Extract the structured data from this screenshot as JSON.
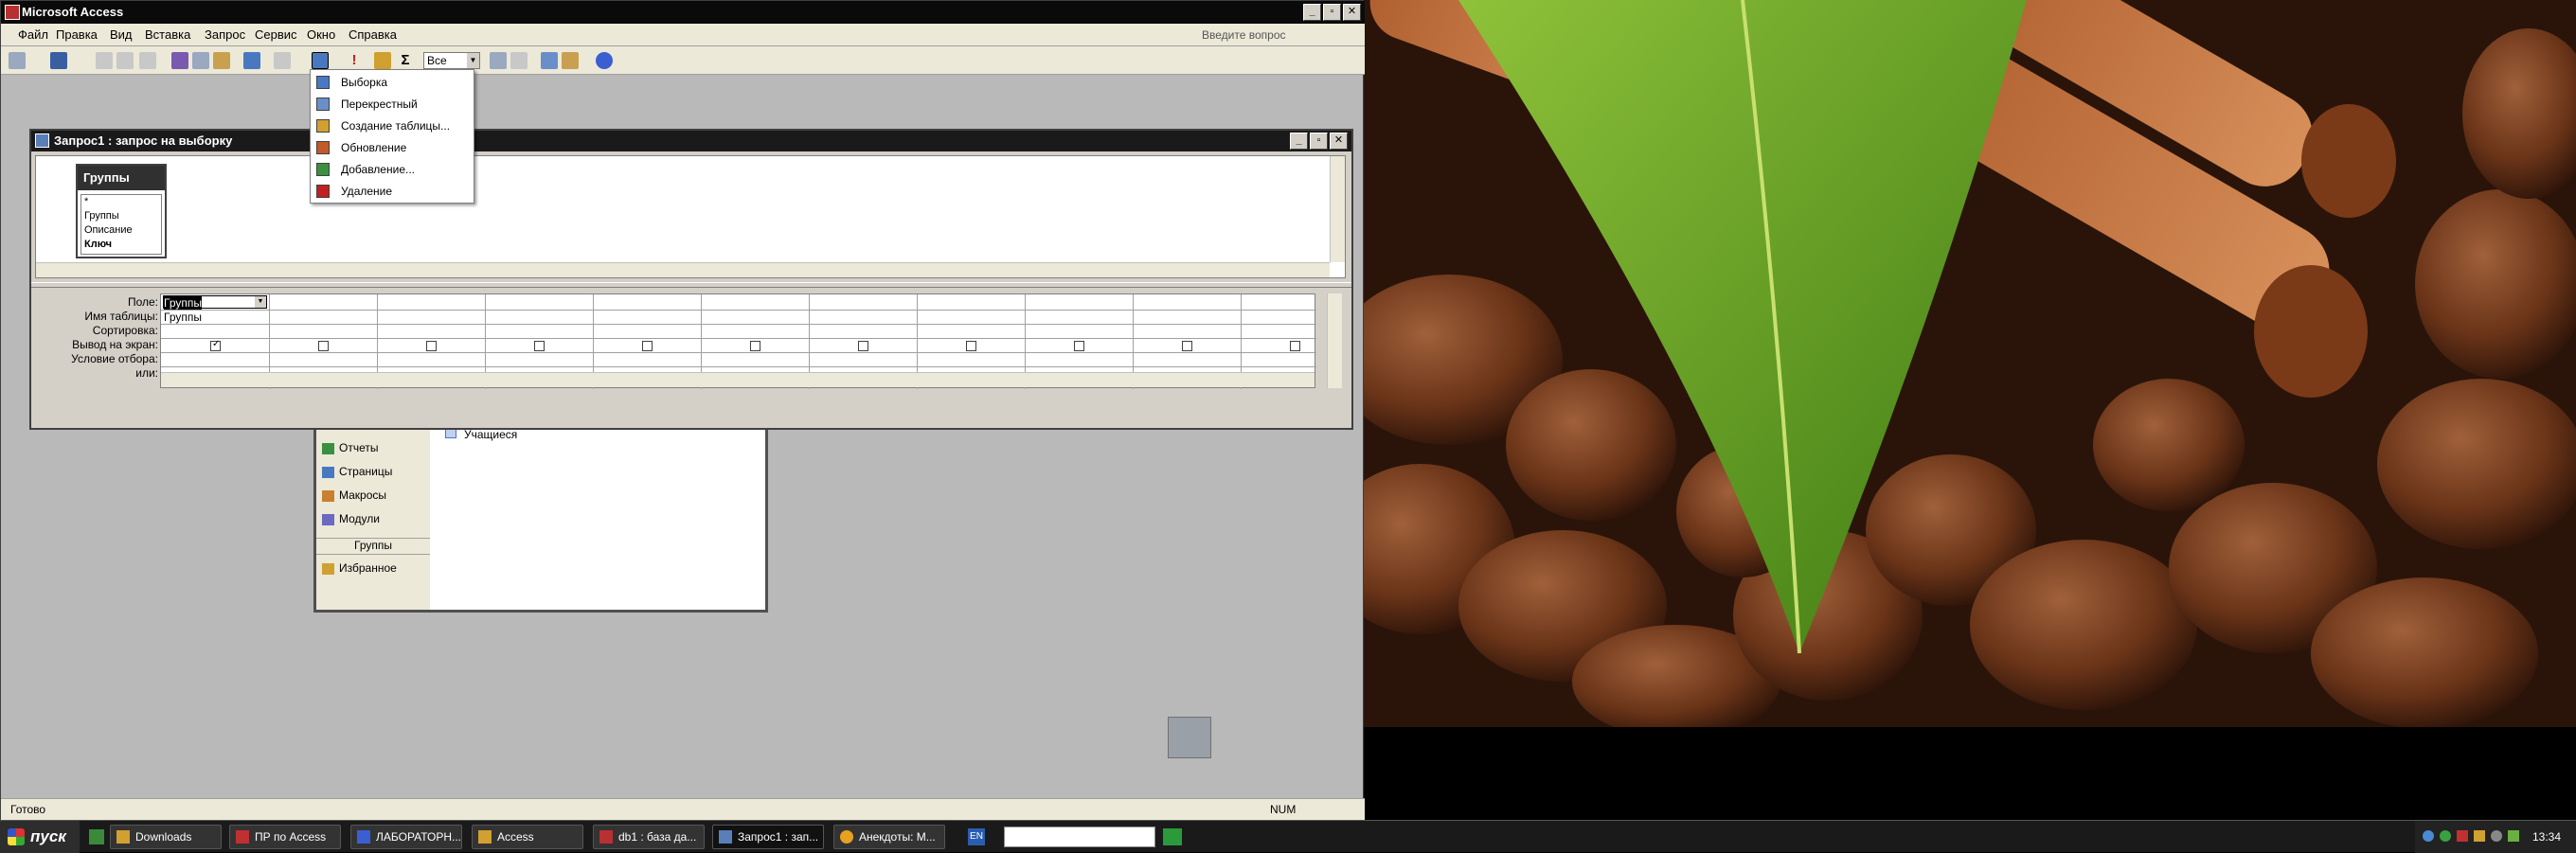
{
  "window": {
    "title": "Microsoft Access",
    "help_placeholder": "Введите вопрос"
  },
  "menu": [
    "Файл",
    "Правка",
    "Вид",
    "Вставка",
    "Запрос",
    "Сервис",
    "Окно",
    "Справка"
  ],
  "toolbar": {
    "combo_value": "Все",
    "sigma": "Σ",
    "exclam": "!"
  },
  "query_type_menu": [
    {
      "label": "Выборка",
      "icon": "select-query-icon",
      "color": "#4a78c0"
    },
    {
      "label": "Перекрестный",
      "icon": "crosstab-query-icon",
      "color": "#6a8ec8"
    },
    {
      "label": "Создание таблицы...",
      "icon": "make-table-icon",
      "color": "#d0a030"
    },
    {
      "label": "Обновление",
      "icon": "update-query-icon",
      "color": "#c05a2a"
    },
    {
      "label": "Добавление...",
      "icon": "append-query-icon",
      "color": "#3a9040"
    },
    {
      "label": "Удаление",
      "icon": "delete-query-icon",
      "color": "#c02020"
    }
  ],
  "query_window": {
    "title": "Запрос1 : запрос на выборку",
    "table": {
      "name": "Группы",
      "fields": [
        "*",
        "Группы",
        "Описание",
        "Ключ"
      ]
    },
    "row_labels": [
      "Поле:",
      "Имя таблицы:",
      "Сортировка:",
      "Вывод на экран:",
      "Условие отбора:",
      "или:"
    ],
    "first_column": {
      "field": "Группы",
      "table": "Группы",
      "shown": true
    }
  },
  "db_window": {
    "items": [
      "Отчеты",
      "Страницы",
      "Макросы",
      "Модули"
    ],
    "group_header": "Группы",
    "favorites": "Избранное",
    "object": "Учащиеся"
  },
  "statusbar": {
    "status": "Готово",
    "num": "NUM"
  },
  "taskbar": {
    "start": "пуск",
    "tasks": [
      "Downloads",
      "ПР по Access",
      "ЛАБОРАТОРН...",
      "Access",
      "db1 : база да...",
      "Запрос1 : зап...",
      "Анекдоты: М..."
    ],
    "lang": "EN",
    "time": "13:34"
  }
}
